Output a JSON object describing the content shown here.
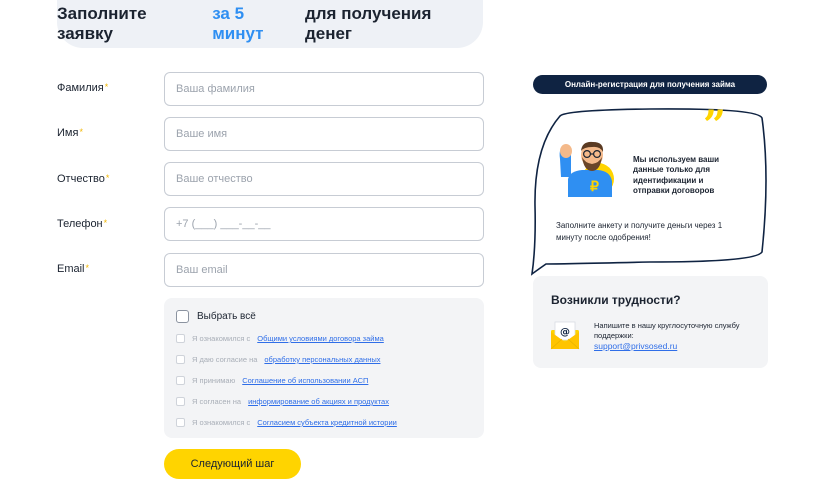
{
  "header": {
    "title_before": "Заполните заявку",
    "title_accent": "за 5 минут",
    "title_after": "для получения денег"
  },
  "form": {
    "required_mark": "*",
    "fields": [
      {
        "label": "Фамилия",
        "placeholder": "Ваша фамилия"
      },
      {
        "label": "Имя",
        "placeholder": "Ваше имя"
      },
      {
        "label": "Отчество",
        "placeholder": "Ваше отчество"
      },
      {
        "label": "Телефон",
        "placeholder": "+7 (___) ___-__-__"
      },
      {
        "label": "Email",
        "placeholder": "Ваш email"
      }
    ],
    "select_all_label": "Выбрать всё",
    "consents": [
      {
        "prefix": "Я ознакомился с",
        "link": "Общими условиями договора займа"
      },
      {
        "prefix": "Я даю согласие на",
        "link": "обработку персональных данных"
      },
      {
        "prefix": "Я принимаю",
        "link": "Соглашение об использовании АСП"
      },
      {
        "prefix": "Я согласен на",
        "link": "информирование об акциях и продуктах"
      },
      {
        "prefix": "Я ознакомился с",
        "link": "Согласием субъекта кредитной истории"
      }
    ],
    "next_button": "Следующий шаг"
  },
  "sidebar": {
    "pill": "Онлайн-регистрация для получения займа",
    "quote_mark": "”",
    "bubble_note": "Мы используем ваши данные только для идентификации и отправки договоров",
    "bubble_sub": "Заполните анкету и получите деньги через 1 минуту после одобрения!",
    "help": {
      "title": "Возникли трудности?",
      "text": "Напишите в нашу круглосуточную службу поддержки:",
      "email": "support@privsosed.ru"
    }
  },
  "colors": {
    "accent_blue": "#2f8ff2",
    "brand_yellow": "#ffd400",
    "navy": "#0f2342",
    "link": "#2f6ee8"
  },
  "icons": [
    "mascot-illustration",
    "quote-icon",
    "mail-icon"
  ]
}
